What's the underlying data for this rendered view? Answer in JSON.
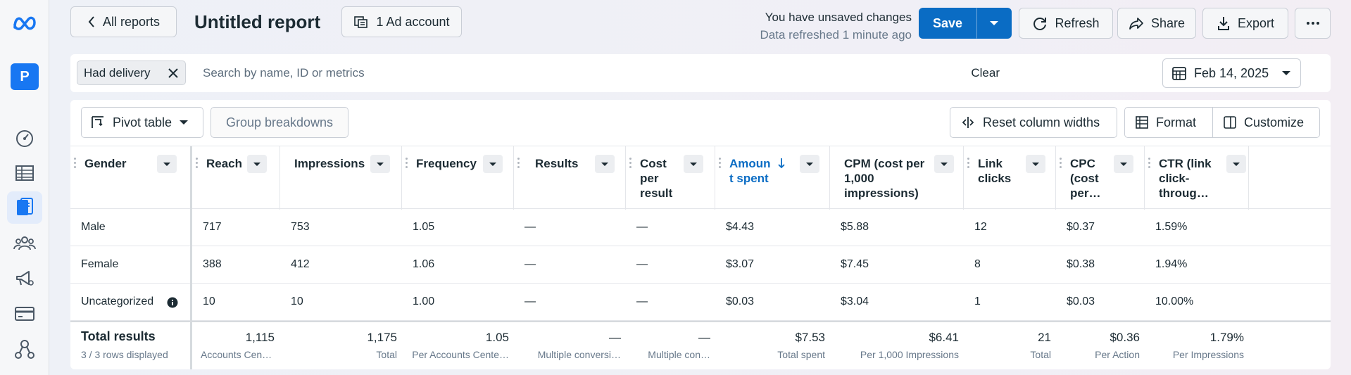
{
  "header": {
    "back_label": "All reports",
    "title": "Untitled report",
    "ad_account_label": "1 Ad account",
    "unsaved_message": "You have unsaved changes",
    "refreshed_message": "Data refreshed 1 minute ago",
    "save_label": "Save",
    "refresh_label": "Refresh",
    "share_label": "Share",
    "export_label": "Export"
  },
  "sidebar": {
    "avatar_letter": "P",
    "icons": [
      "meta-logo-icon",
      "dashboard-gauge-icon",
      "table-icon",
      "reports-icon",
      "audience-icon",
      "campaign-megaphone-icon",
      "billing-card-icon",
      "business-network-icon"
    ]
  },
  "filters": {
    "chip_label": "Had delivery",
    "search_placeholder": "Search by name, ID or metrics",
    "clear_label": "Clear",
    "date_label": "Feb 14, 2025"
  },
  "toolbar": {
    "pivot_label": "Pivot table",
    "group_label": "Group breakdowns",
    "reset_label": "Reset column widths",
    "format_label": "Format",
    "customize_label": "Customize"
  },
  "table": {
    "columns": [
      {
        "line1": "Gender",
        "line2": "",
        "line3": ""
      },
      {
        "line1": "Reach",
        "line2": "",
        "line3": ""
      },
      {
        "line1": "Impressions",
        "line2": "",
        "line3": ""
      },
      {
        "line1": "Frequency",
        "line2": "",
        "line3": ""
      },
      {
        "line1": "Results",
        "line2": "",
        "line3": ""
      },
      {
        "line1": "Cost",
        "line2": "per",
        "line3": "result"
      },
      {
        "line1": "Amoun",
        "line2": "t spent",
        "line3": ""
      },
      {
        "line1": "CPM (cost per",
        "line2": "1,000",
        "line3": "impressions)"
      },
      {
        "line1": "Link",
        "line2": "clicks",
        "line3": ""
      },
      {
        "line1": "CPC",
        "line2": "(cost",
        "line3": "per…"
      },
      {
        "line1": "CTR (link",
        "line2": "click-",
        "line3": "throug…"
      }
    ],
    "rows": [
      [
        "Male",
        "717",
        "753",
        "1.05",
        "—",
        "—",
        "$4.43",
        "$5.88",
        "12",
        "$0.37",
        "1.59%"
      ],
      [
        "Female",
        "388",
        "412",
        "1.06",
        "—",
        "—",
        "$3.07",
        "$7.45",
        "8",
        "$0.38",
        "1.94%"
      ],
      [
        "Uncategorized",
        "10",
        "10",
        "1.00",
        "—",
        "—",
        "$0.03",
        "$3.04",
        "1",
        "$0.03",
        "10.00%"
      ]
    ],
    "totals": {
      "label": "Total results",
      "sublabel": "3 / 3 rows displayed",
      "values": [
        "1,115",
        "1,175",
        "1.05",
        "—",
        "—",
        "$7.53",
        "$6.41",
        "21",
        "$0.36",
        "1.79%"
      ],
      "notes": [
        "Accounts Cen…",
        "Total",
        "Per Accounts Cente…",
        "Multiple conversi…",
        "Multiple con…",
        "Total spent",
        "Per 1,000 Impressions",
        "Total",
        "Per Action",
        "Per Impressions"
      ]
    }
  },
  "colors": {
    "primary": "#0a6cc4",
    "sorted_header": "#0a6cc4",
    "brand": "#1877f2"
  }
}
